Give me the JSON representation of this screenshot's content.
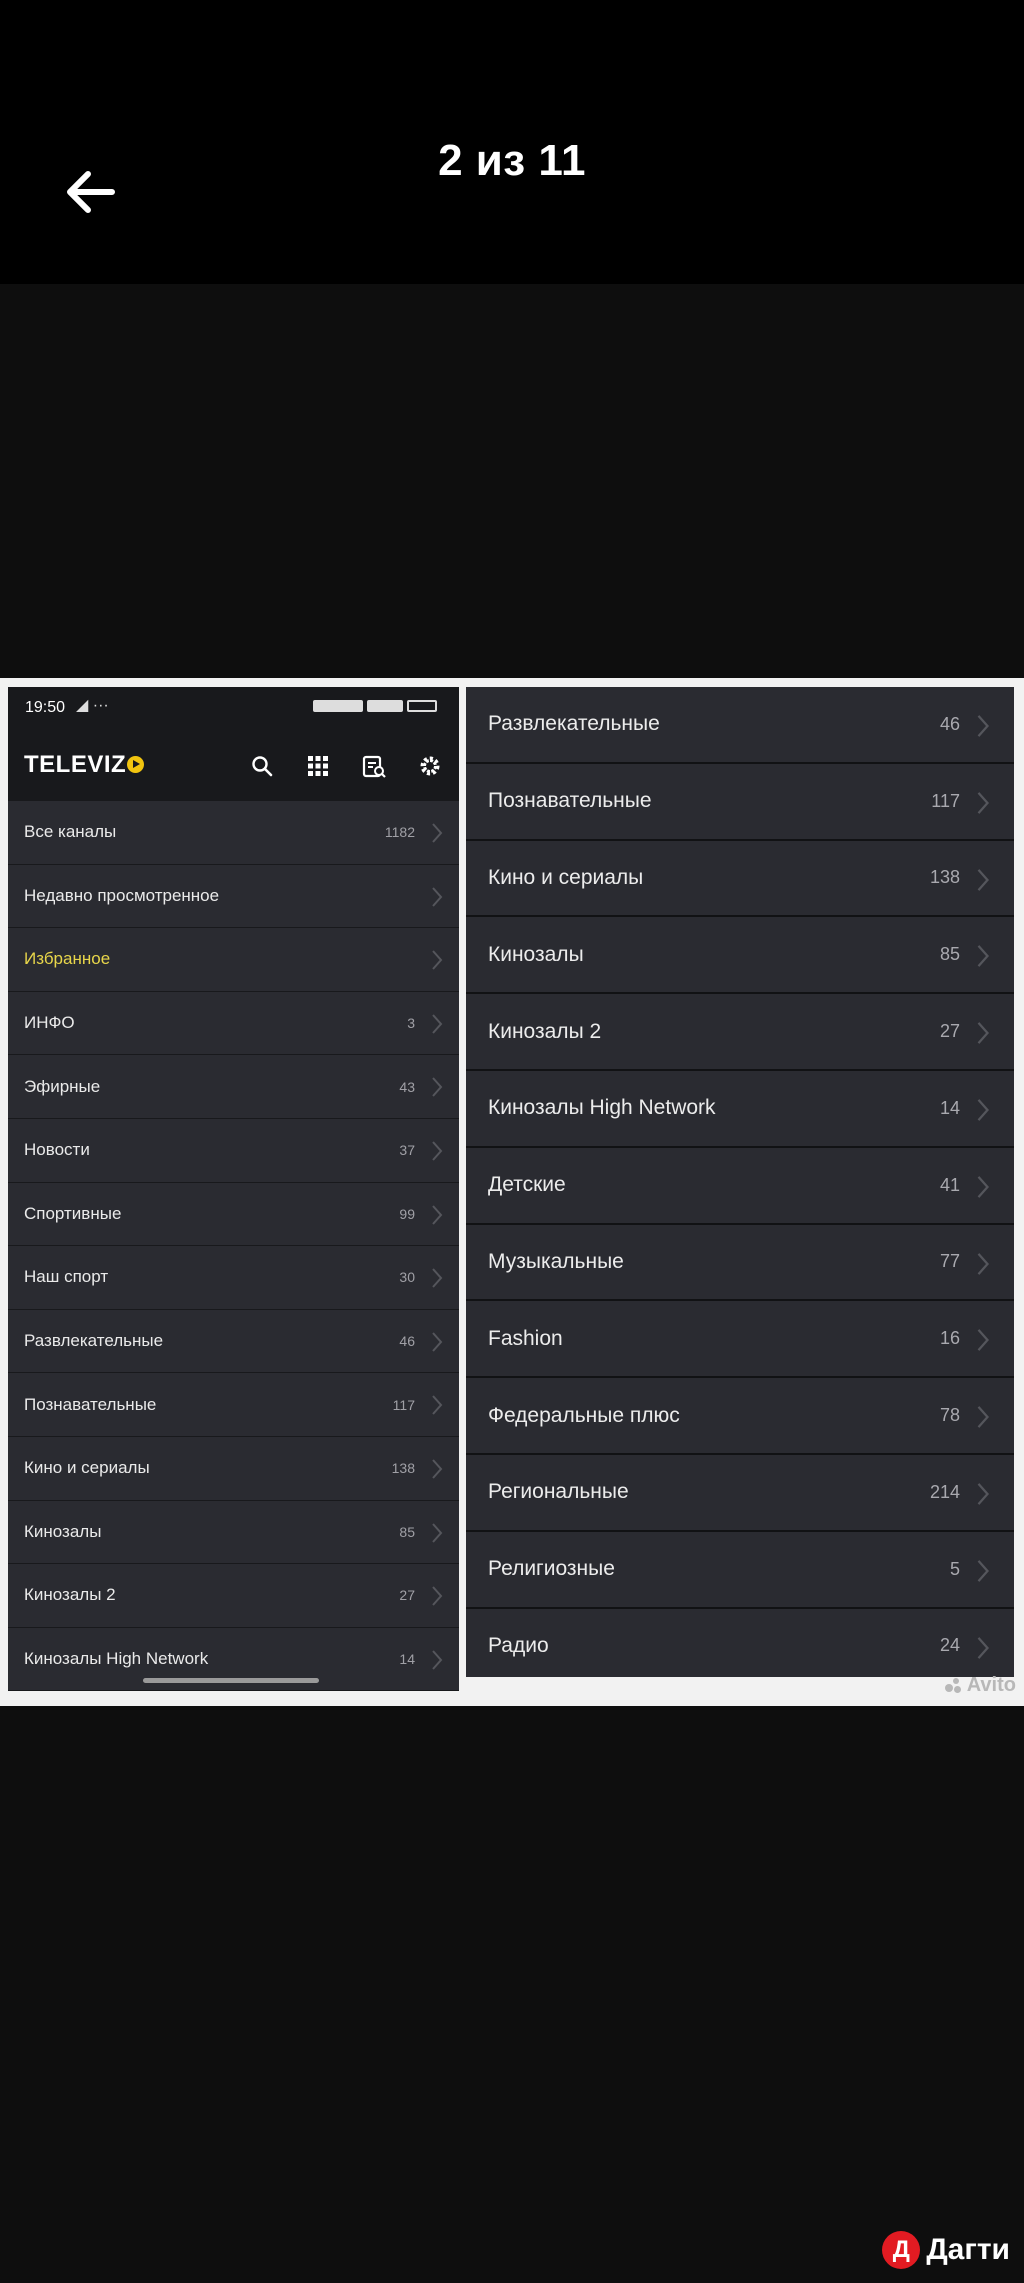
{
  "viewer": {
    "counter": "2 из 11"
  },
  "phone": {
    "time": "19:50",
    "time_extra": "◢ ···",
    "app_name": "TELEVIZ",
    "list": [
      {
        "label": "Все каналы",
        "count": "1182"
      },
      {
        "label": "Недавно просмотренное",
        "count": ""
      },
      {
        "label": "Избранное",
        "count": "",
        "highlight": true
      },
      {
        "label": "ИНФО",
        "count": "3"
      },
      {
        "label": "Эфирные",
        "count": "43"
      },
      {
        "label": "Новости",
        "count": "37"
      },
      {
        "label": "Спортивные",
        "count": "99"
      },
      {
        "label": "Наш спорт",
        "count": "30"
      },
      {
        "label": "Развлекательные",
        "count": "46"
      },
      {
        "label": "Познавательные",
        "count": "117"
      },
      {
        "label": "Кино и сериалы",
        "count": "138"
      },
      {
        "label": "Кинозалы",
        "count": "85"
      },
      {
        "label": "Кинозалы 2",
        "count": "27"
      },
      {
        "label": "Кинозалы High Network",
        "count": "14"
      }
    ],
    "logo_color": "#f1c40f",
    "highlight_color": "#e8d64a"
  },
  "categories": [
    {
      "label": "Развлекательные",
      "count": "46"
    },
    {
      "label": "Познавательные",
      "count": "117"
    },
    {
      "label": "Кино и сериалы",
      "count": "138"
    },
    {
      "label": "Кинозалы",
      "count": "85"
    },
    {
      "label": "Кинозалы 2",
      "count": "27"
    },
    {
      "label": "Кинозалы High Network",
      "count": "14"
    },
    {
      "label": "Детские",
      "count": "41"
    },
    {
      "label": "Музыкальные",
      "count": "77"
    },
    {
      "label": "Fashion",
      "count": "16"
    },
    {
      "label": "Федеральные плюс",
      "count": "78"
    },
    {
      "label": "Региональные",
      "count": "214"
    },
    {
      "label": "Религиозные",
      "count": "5"
    },
    {
      "label": "Радио",
      "count": "24"
    }
  ],
  "watermark": "Avito",
  "brand": {
    "badge": "Д",
    "name": "Дагти",
    "color": "#e21b22"
  }
}
